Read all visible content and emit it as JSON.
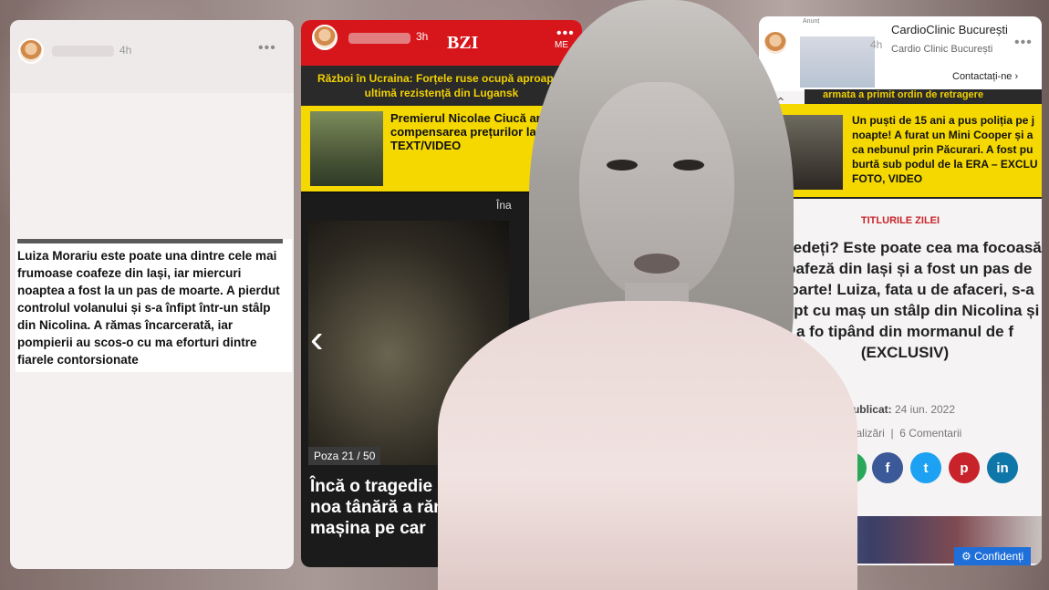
{
  "story_left": {
    "time": "4h",
    "text": "Luiza Morariu este poate una dintre cele mai frumoase coafeze din Iași, iar miercuri noaptea a fost la un pas de moarte. A pierdut controlul volanului și s-a înfipt într-un stâlp din Nicolina. A rămas încarcerată, iar pompierii au scos-o cu ma eforturi dintre fiarele contorsionate"
  },
  "story_mid": {
    "time": "3h",
    "logo": "BZI",
    "menu": "ME",
    "breaking": "Război în Ucraina: Forțele ruse ocupă aproape i ultimă rezistență din Lugansk",
    "promo": "Premierul Nicolae Ciucă ar compensarea prețurilor la LIVE TEXT/VIDEO",
    "in_app": "Îna",
    "gallery_counter": "Poza 21 / 50",
    "headline": "Încă o tragedie e milimetru azi noa tânără a rămas în ce mașina pe car"
  },
  "story_right": {
    "time": "4h",
    "ad_label": "Anunț",
    "ad_title": "CardioClinic București",
    "ad_sub": "Cardio Clinic București",
    "ad_cta": "Contactați-ne",
    "ticker": "armata a primit ordin de retragere",
    "promo": "Un puști de 15 ani a pus poliția pe j noapte! A furat un Mini Cooper și a ca nebunul prin Păcurari. A fost pu burtă sub podul de la ERA – EXCLU FOTO, VIDEO",
    "section": "TITLURILE ZILEI",
    "headline": "O vedeți? Este poate cea ma focoasă coafeză din Iași și a fost un pas de moarte! Luiza, fata u de afaceri, s-a înfipt cu maș un stâlp din Nicolina și a fo tipând din mormanul de f (EXCLUSIV)",
    "published_label": "Publicat:",
    "published_date": "24 iun. 2022",
    "views": "868 Vizualizări",
    "comments": "6 Comentarii",
    "consent": "Confidenți"
  },
  "colors": {
    "bzi_red": "#d7161c",
    "yellow": "#f4d800",
    "ticker": "#f1d100",
    "section_red": "#c8232a"
  }
}
